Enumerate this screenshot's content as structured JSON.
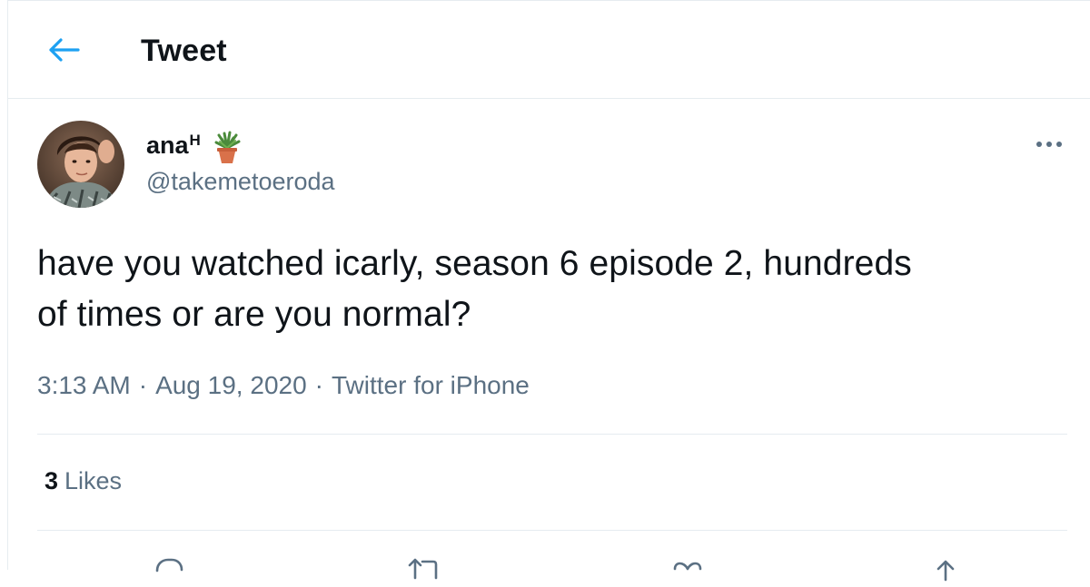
{
  "header": {
    "title": "Tweet",
    "back_icon": "arrow-left-icon",
    "accent_color": "#1da1f2"
  },
  "author": {
    "display_name": "ana",
    "display_name_sup": "H",
    "emoji_icon": "potted-plant-icon",
    "handle": "@takemetoeroda",
    "avatar_icon": "avatar-photo"
  },
  "more_icon": "more-horizontal-icon",
  "tweet": {
    "text_line1": "have you watched icarly, season 6 episode 2, hundreds",
    "text_line2": "of times or are you normal?"
  },
  "meta": {
    "time": "3:13 AM",
    "separator": "·",
    "date": "Aug 19, 2020",
    "source": "Twitter for iPhone"
  },
  "stats": {
    "likes_count": "3",
    "likes_label": "Likes"
  },
  "actions": [
    {
      "icon": "reply-icon"
    },
    {
      "icon": "retweet-icon"
    },
    {
      "icon": "like-icon"
    },
    {
      "icon": "share-icon"
    }
  ],
  "colors": {
    "text_primary": "#0f1419",
    "text_secondary": "#5b7083",
    "border": "#e6ecf0"
  }
}
